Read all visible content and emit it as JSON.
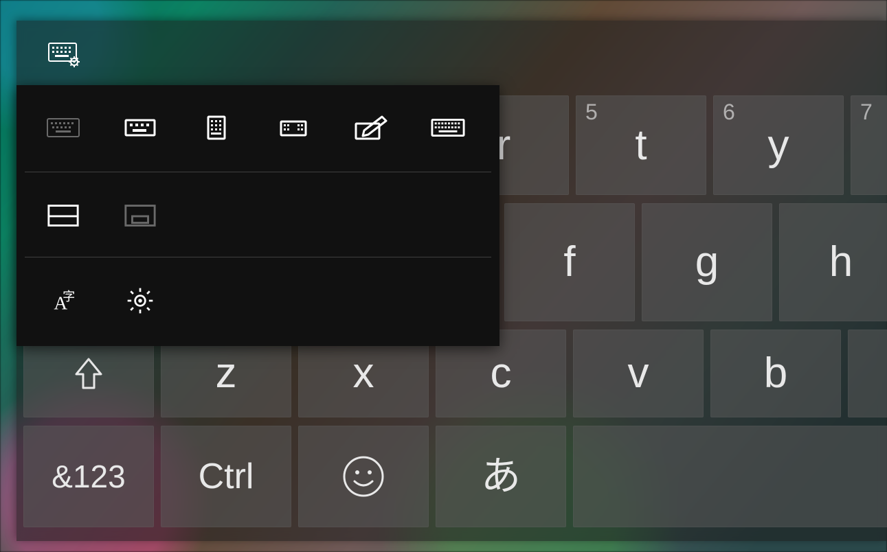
{
  "keyboard": {
    "row1": [
      {
        "label": "r",
        "hint": ""
      },
      {
        "label": "t",
        "hint": "5"
      },
      {
        "label": "y",
        "hint": "6"
      },
      {
        "label": "",
        "hint": "7"
      }
    ],
    "row2": [
      {
        "label": "f",
        "hint": ""
      },
      {
        "label": "g",
        "hint": ""
      },
      {
        "label": "h",
        "hint": ""
      }
    ],
    "row3_shift": "",
    "row3": [
      {
        "label": "z",
        "hint": ""
      },
      {
        "label": "x",
        "hint": ""
      },
      {
        "label": "c",
        "hint": ""
      },
      {
        "label": "v",
        "hint": ""
      },
      {
        "label": "b",
        "hint": ""
      }
    ],
    "row4": {
      "symbols": "&123",
      "ctrl": "Ctrl",
      "emoji": "☺",
      "lang": "あ"
    }
  },
  "popup": {
    "layouts": [
      "default",
      "small",
      "one-handed",
      "split",
      "handwriting",
      "full"
    ],
    "dock": [
      "docked",
      "floating"
    ],
    "actions": [
      "language",
      "settings"
    ]
  }
}
